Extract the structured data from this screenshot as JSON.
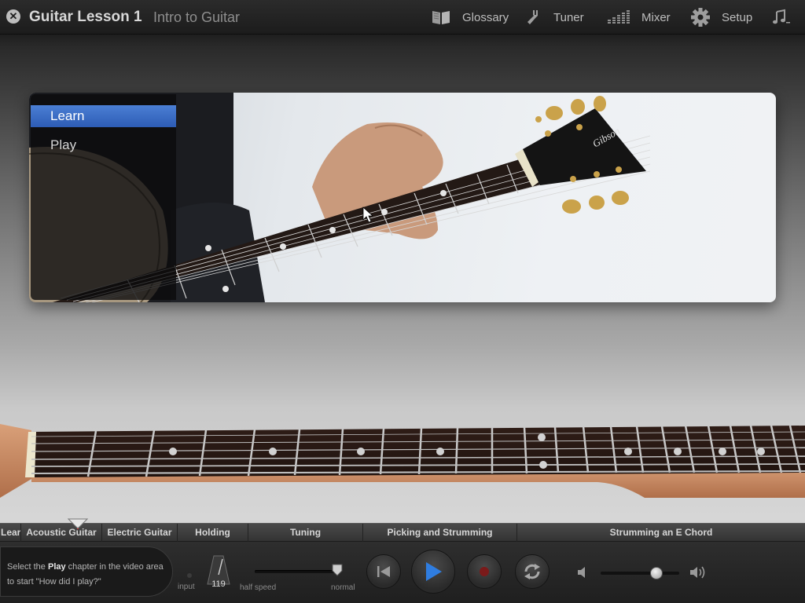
{
  "header": {
    "title": "Guitar Lesson 1",
    "subtitle": "Intro to Guitar",
    "close_icon": "close-icon",
    "tools": [
      {
        "label": "Glossary",
        "icon": "book-icon"
      },
      {
        "label": "Tuner",
        "icon": "tuning-fork-icon"
      },
      {
        "label": "Mixer",
        "icon": "mixer-bars-icon"
      },
      {
        "label": "Setup",
        "icon": "gear-icon"
      },
      {
        "label": "",
        "icon": "music-note-icon"
      }
    ]
  },
  "video": {
    "menu": [
      {
        "label": "Learn",
        "selected": true
      },
      {
        "label": "Play",
        "selected": false
      }
    ]
  },
  "chapters": [
    {
      "label": "Lear"
    },
    {
      "label": "Acoustic Guitar"
    },
    {
      "label": "Electric Guitar"
    },
    {
      "label": "Holding"
    },
    {
      "label": "Tuning"
    },
    {
      "label": "Picking and Strumming"
    },
    {
      "label": "Strumming an E Chord"
    }
  ],
  "transport": {
    "hint_pre": "Select the ",
    "hint_bold": "Play",
    "hint_post": " chapter in the video area to start \"How did I play?\"",
    "input_label": "input",
    "tempo": "119",
    "half_speed_label": "half speed",
    "normal_label": "normal",
    "speed_fraction": 1.0,
    "volume_fraction": 0.72
  },
  "colors": {
    "accent_blue": "#2f7de0",
    "record_red": "#8a1a1a",
    "menu_selected": "#3a6ac6"
  }
}
